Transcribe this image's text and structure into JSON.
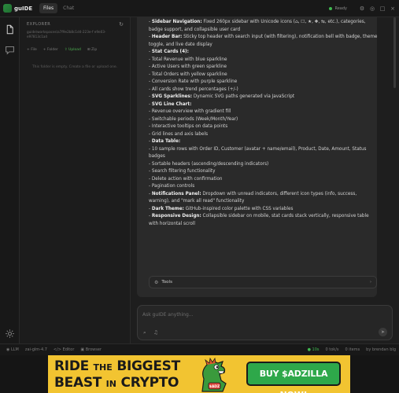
{
  "app": {
    "name": "guIDE"
  },
  "topbar": {
    "tabs": [
      {
        "label": "Files",
        "active": true
      },
      {
        "label": "Chat",
        "active": false
      }
    ],
    "status": "Ready",
    "icons": [
      "settings-icon",
      "globe-icon",
      "window-icon",
      "close-icon"
    ]
  },
  "explorer": {
    "title": "EXPLORER",
    "path": "guide\\workspaces\\a7f9e2b8c1d4-223e-f e9e03-e97813c1a4",
    "actions": [
      {
        "label": "+ File"
      },
      {
        "label": "+ Folder"
      },
      {
        "label": "Upload"
      },
      {
        "label": "Zip"
      }
    ],
    "empty_message": "This folder is empty. Create a file or upload one."
  },
  "chat": {
    "lines": [
      {
        "label": "Sidebar Navigation:",
        "text": " Fixed 260px sidebar with Unicode icons (⌂, ☐, ★, ✚, ⇆, etc.), categories, badge support, and collapsible user card"
      },
      {
        "label": "Header Bar:",
        "text": " Sticky top header with search input (with filtering), notification bell with badge, theme toggle, and live date display"
      },
      {
        "label": "Stat Cards (4):",
        "text": ""
      },
      {
        "label": "",
        "text": "- Total Revenue with blue sparkline"
      },
      {
        "label": "",
        "text": "- Active Users with green sparkline"
      },
      {
        "label": "",
        "text": "- Total Orders with yellow sparkline"
      },
      {
        "label": "",
        "text": "- Conversion Rate with purple sparkline"
      },
      {
        "label": "",
        "text": "- All cards show trend percentages (+/-)"
      },
      {
        "label": "SVG Sparklines:",
        "text": " Dynamic SVG paths generated via JavaScript"
      },
      {
        "label": "SVG Line Chart:",
        "text": ""
      },
      {
        "label": "",
        "text": "- Revenue overview with gradient fill"
      },
      {
        "label": "",
        "text": "- Switchable periods (Week/Month/Year)"
      },
      {
        "label": "",
        "text": "- Interactive tooltips on data points"
      },
      {
        "label": "",
        "text": "- Grid lines and axis labels"
      },
      {
        "label": "Data Table:",
        "text": ""
      },
      {
        "label": "",
        "text": "- 10 sample rows with Order ID, Customer (avatar + name/email), Product, Date, Amount, Status badges"
      },
      {
        "label": "",
        "text": "- Sortable headers (ascending/descending indicators)"
      },
      {
        "label": "",
        "text": "- Search filtering functionality"
      },
      {
        "label": "",
        "text": "- Delete action with confirmation"
      },
      {
        "label": "",
        "text": "- Pagination controls"
      },
      {
        "label": "Notifications Panel:",
        "text": " Dropdown with unread indicators, different icon types (info, success, warning), and \"mark all read\" functionality"
      },
      {
        "label": "Dark Theme:",
        "text": " GitHub-inspired color palette with CSS variables"
      },
      {
        "label": "Responsive Design:",
        "text": " Collapsible sidebar on mobile, stat cards stack vertically, responsive table with horizontal scroll"
      }
    ],
    "tools_label": "Tools"
  },
  "input": {
    "placeholder": "Ask guIDE anything..."
  },
  "statusbar": {
    "left": [
      {
        "label": "LLM"
      },
      {
        "label": "zai-glm-4.7"
      },
      {
        "label": "</> Editor"
      },
      {
        "label": "Browser"
      }
    ],
    "right": [
      {
        "label": "10s"
      },
      {
        "label": "0 tok/s"
      },
      {
        "label": "0 items"
      },
      {
        "label": "by brendan blg"
      }
    ]
  },
  "ad": {
    "line1_big": "RIDE",
    "line1_small": "THE",
    "line1_big2": "BIGGEST",
    "line2_big": "BEAST",
    "line2_small": "IN",
    "line2_big2": "CRYPTO",
    "mascot_label": "$ADZ",
    "cta": "BUY $ADZILLA NOW!"
  },
  "colors": {
    "accent_green": "#3fb950",
    "ad_yellow": "#f2c431",
    "ad_button": "#2ea84a"
  }
}
